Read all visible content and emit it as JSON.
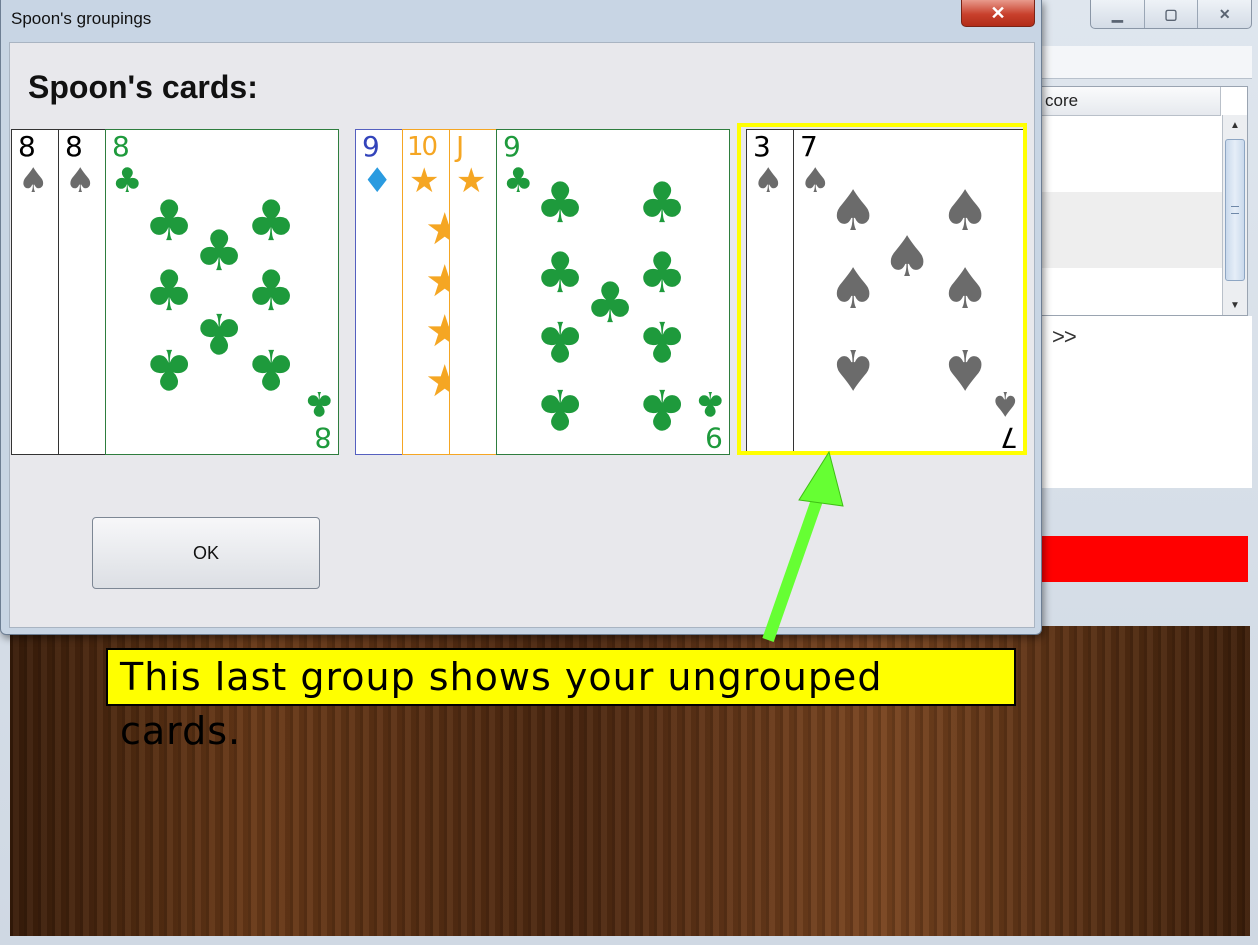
{
  "background_window": {
    "caption_buttons": [
      "▁",
      "▢",
      "✕"
    ],
    "table_header": "core",
    "next_label": ">>"
  },
  "dialog": {
    "title": "Spoon's groupings",
    "close_label": "✕",
    "heading": "Spoon's cards:",
    "ok_label": "OK"
  },
  "groups": [
    {
      "cards": [
        {
          "rank": "8",
          "suit": "spade",
          "glyph": "♠",
          "color": "#6b6b6b"
        },
        {
          "rank": "8",
          "suit": "spade",
          "glyph": "♠",
          "color": "#6b6b6b"
        },
        {
          "rank": "8",
          "suit": "club",
          "glyph": "♣",
          "color": "#1e9a3c"
        }
      ]
    },
    {
      "cards": [
        {
          "rank": "9",
          "suit": "diamond",
          "glyph": "♦",
          "color": "#2a9be0",
          "rank_color": "#3344bb"
        },
        {
          "rank": "10",
          "suit": "star",
          "glyph": "★",
          "color": "#f5a623"
        },
        {
          "rank": "J",
          "suit": "star",
          "glyph": "★",
          "color": "#f5a623"
        },
        {
          "rank": "9",
          "suit": "club",
          "glyph": "♣",
          "color": "#1e9a3c"
        }
      ]
    },
    {
      "cards": [
        {
          "rank": "3",
          "suit": "spade",
          "glyph": "♠",
          "color": "#6b6b6b",
          "rank_color": "#000000"
        },
        {
          "rank": "7",
          "suit": "spade",
          "glyph": "♠",
          "color": "#6b6b6b",
          "rank_color": "#000000"
        }
      ]
    }
  ],
  "annotation": {
    "text": "This last group shows your ungrouped cards.",
    "highlight_color": "#ffff00",
    "arrow_color": "#66ff33"
  }
}
